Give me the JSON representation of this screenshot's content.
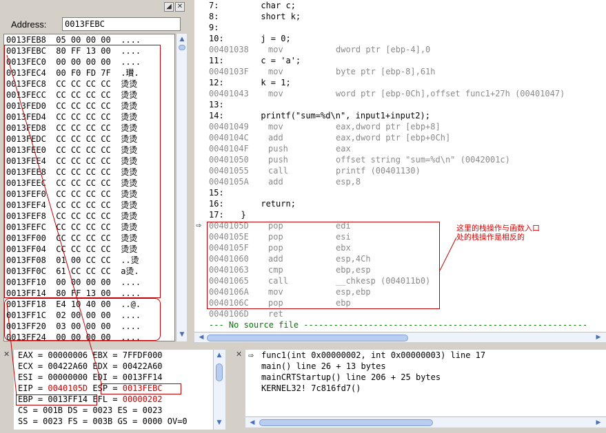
{
  "memory": {
    "address_label": "Address:",
    "address_value": "0013FEBC",
    "rows": [
      [
        "0013FEB8",
        "05 00 00 00",
        "...."
      ],
      [
        "0013FEBC",
        "80 FF 13 00",
        "...."
      ],
      [
        "0013FEC0",
        "00 00 00 00",
        "...."
      ],
      [
        "0013FEC4",
        "00 F0 FD 7F",
        ".瓉."
      ],
      [
        "0013FEC8",
        "CC CC CC CC",
        "烫烫"
      ],
      [
        "0013FECC",
        "CC CC CC CC",
        "烫烫"
      ],
      [
        "0013FED0",
        "CC CC CC CC",
        "烫烫"
      ],
      [
        "0013FED4",
        "CC CC CC CC",
        "烫烫"
      ],
      [
        "0013FED8",
        "CC CC CC CC",
        "烫烫"
      ],
      [
        "0013FEDC",
        "CC CC CC CC",
        "烫烫"
      ],
      [
        "0013FEE0",
        "CC CC CC CC",
        "烫烫"
      ],
      [
        "0013FEE4",
        "CC CC CC CC",
        "烫烫"
      ],
      [
        "0013FEE8",
        "CC CC CC CC",
        "烫烫"
      ],
      [
        "0013FEEC",
        "CC CC CC CC",
        "烫烫"
      ],
      [
        "0013FEF0",
        "CC CC CC CC",
        "烫烫"
      ],
      [
        "0013FEF4",
        "CC CC CC CC",
        "烫烫"
      ],
      [
        "0013FEF8",
        "CC CC CC CC",
        "烫烫"
      ],
      [
        "0013FEFC",
        "CC CC CC CC",
        "烫烫"
      ],
      [
        "0013FF00",
        "CC CC CC CC",
        "烫烫"
      ],
      [
        "0013FF04",
        "CC CC CC CC",
        "烫烫"
      ],
      [
        "0013FF08",
        "01 00 CC CC",
        "..烫"
      ],
      [
        "0013FF0C",
        "61 CC CC CC",
        "a烫."
      ],
      [
        "0013FF10",
        "00 00 00 00",
        "...."
      ],
      [
        "0013FF14",
        "80 FF 13 00",
        "...."
      ],
      [
        "0013FF18",
        "E4 10 40 00",
        "..@."
      ],
      [
        "0013FF1C",
        "02 00 00 00",
        "...."
      ],
      [
        "0013FF20",
        "03 00 00 00",
        "...."
      ],
      [
        "0013FF24",
        "00 00 00 00",
        "...."
      ]
    ]
  },
  "source": {
    "lines": [
      {
        "kind": "src",
        "ln": "7:",
        "code": "      char c;"
      },
      {
        "kind": "src",
        "ln": "8:",
        "code": "      short k;"
      },
      {
        "kind": "src",
        "ln": "9:",
        "code": ""
      },
      {
        "kind": "src",
        "ln": "10:",
        "code": "      j = 0;"
      },
      {
        "kind": "asm",
        "addr": "00401038",
        "op": "mov",
        "args": "dword ptr [ebp-4],0"
      },
      {
        "kind": "src",
        "ln": "11:",
        "code": "      c = 'a';"
      },
      {
        "kind": "asm",
        "addr": "0040103F",
        "op": "mov",
        "args": "byte ptr [ebp-8],61h"
      },
      {
        "kind": "src",
        "ln": "12:",
        "code": "      k = 1;"
      },
      {
        "kind": "asm",
        "addr": "00401043",
        "op": "mov",
        "args": "word ptr [ebp-0Ch],offset func1+27h (00401047)"
      },
      {
        "kind": "src",
        "ln": "13:",
        "code": ""
      },
      {
        "kind": "src",
        "ln": "14:",
        "code": "      printf(\"sum=%d\\n\", input1+input2);"
      },
      {
        "kind": "asm",
        "addr": "00401049",
        "op": "mov",
        "args": "eax,dword ptr [ebp+8]"
      },
      {
        "kind": "asm",
        "addr": "0040104C",
        "op": "add",
        "args": "eax,dword ptr [ebp+0Ch]"
      },
      {
        "kind": "asm",
        "addr": "0040104F",
        "op": "push",
        "args": "eax"
      },
      {
        "kind": "asm",
        "addr": "00401050",
        "op": "push",
        "args": "offset string \"sum=%d\\n\" (0042001c)"
      },
      {
        "kind": "asm",
        "addr": "00401055",
        "op": "call",
        "args": "printf (00401130)"
      },
      {
        "kind": "asm",
        "addr": "0040105A",
        "op": "add",
        "args": "esp,8"
      },
      {
        "kind": "src",
        "ln": "15:",
        "code": ""
      },
      {
        "kind": "src",
        "ln": "16:",
        "code": "      return;"
      },
      {
        "kind": "src",
        "ln": "17:",
        "code": "  }"
      },
      {
        "kind": "asm",
        "addr": "0040105D",
        "op": "pop",
        "args": "edi"
      },
      {
        "kind": "asm",
        "addr": "0040105E",
        "op": "pop",
        "args": "esi"
      },
      {
        "kind": "asm",
        "addr": "0040105F",
        "op": "pop",
        "args": "ebx"
      },
      {
        "kind": "asm",
        "addr": "00401060",
        "op": "add",
        "args": "esp,4Ch"
      },
      {
        "kind": "asm",
        "addr": "00401063",
        "op": "cmp",
        "args": "ebp,esp"
      },
      {
        "kind": "asm",
        "addr": "00401065",
        "op": "call",
        "args": "__chkesp (004011b0)"
      },
      {
        "kind": "asm",
        "addr": "0040106A",
        "op": "mov",
        "args": "esp,ebp"
      },
      {
        "kind": "asm",
        "addr": "0040106C",
        "op": "pop",
        "args": "ebp"
      },
      {
        "kind": "asm",
        "addr": "0040106D",
        "op": "ret",
        "args": ""
      },
      {
        "kind": "nosrc",
        "text": "--- No source file ---------------------------------------------------------"
      }
    ]
  },
  "annotation": "这里的栈操作与函数入口处的栈操作是相反的",
  "registers": {
    "lines": [
      [
        {
          "t": "EAX = 00000006 EBX = 7FFDF000"
        }
      ],
      [
        {
          "t": "ECX = 00422A60 EDX = 00422A60"
        }
      ],
      [
        {
          "t": "ESI = 00000000 EDI = 0013FF14"
        }
      ],
      [
        {
          "t": "EIP = "
        },
        {
          "t": "0040105D",
          "red": true
        },
        {
          "t": " ESP = "
        },
        {
          "t": "0013FEBC",
          "red": true
        }
      ],
      [
        {
          "t": "EBP = 0013FF14 EFL = "
        },
        {
          "t": "00000202",
          "red": true
        }
      ],
      [
        {
          "t": "CS = 001B DS = 0023 ES = 0023"
        }
      ],
      [
        {
          "t": "SS = 0023 FS = 003B GS = 0000 OV=0"
        }
      ]
    ]
  },
  "callstack": {
    "lines": [
      "func1(int 0x00000002, int 0x00000003) line 17",
      "main() line 26 + 13 bytes",
      "mainCRTStartup() line 206 + 25 bytes",
      "KERNEL32! 7c816fd7()"
    ]
  }
}
